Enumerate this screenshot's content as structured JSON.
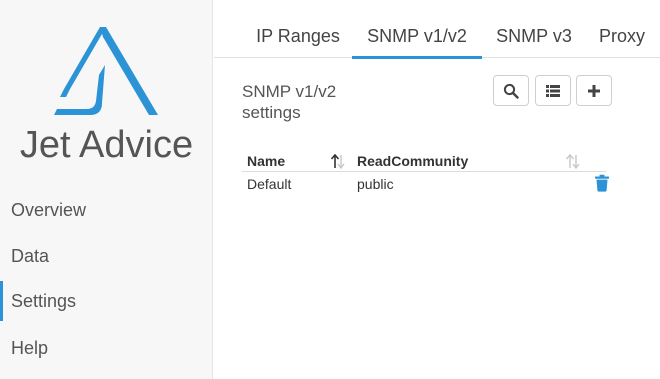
{
  "brand": {
    "name": "Jet Advice",
    "color": "#2b93d6"
  },
  "sidebar": {
    "items": [
      {
        "label": "Overview",
        "active": false
      },
      {
        "label": "Data",
        "active": false
      },
      {
        "label": "Settings",
        "active": true
      },
      {
        "label": "Help",
        "active": false
      }
    ]
  },
  "tabs": [
    {
      "label": "IP Ranges",
      "active": false
    },
    {
      "label": "SNMP v1/v2",
      "active": true
    },
    {
      "label": "SNMP v3",
      "active": false
    },
    {
      "label": "Proxy",
      "active": false
    }
  ],
  "section": {
    "title": "SNMP v1/v2 settings"
  },
  "toolbar": {
    "search_icon": "search-icon",
    "list_icon": "list-icon",
    "add_icon": "plus-icon"
  },
  "table": {
    "columns": [
      {
        "label": "Name",
        "sort": "ascending"
      },
      {
        "label": "ReadCommunity",
        "sort": "none"
      }
    ],
    "rows": [
      {
        "name": "Default",
        "read_community": "public",
        "action_icon": "trash-icon"
      }
    ]
  }
}
